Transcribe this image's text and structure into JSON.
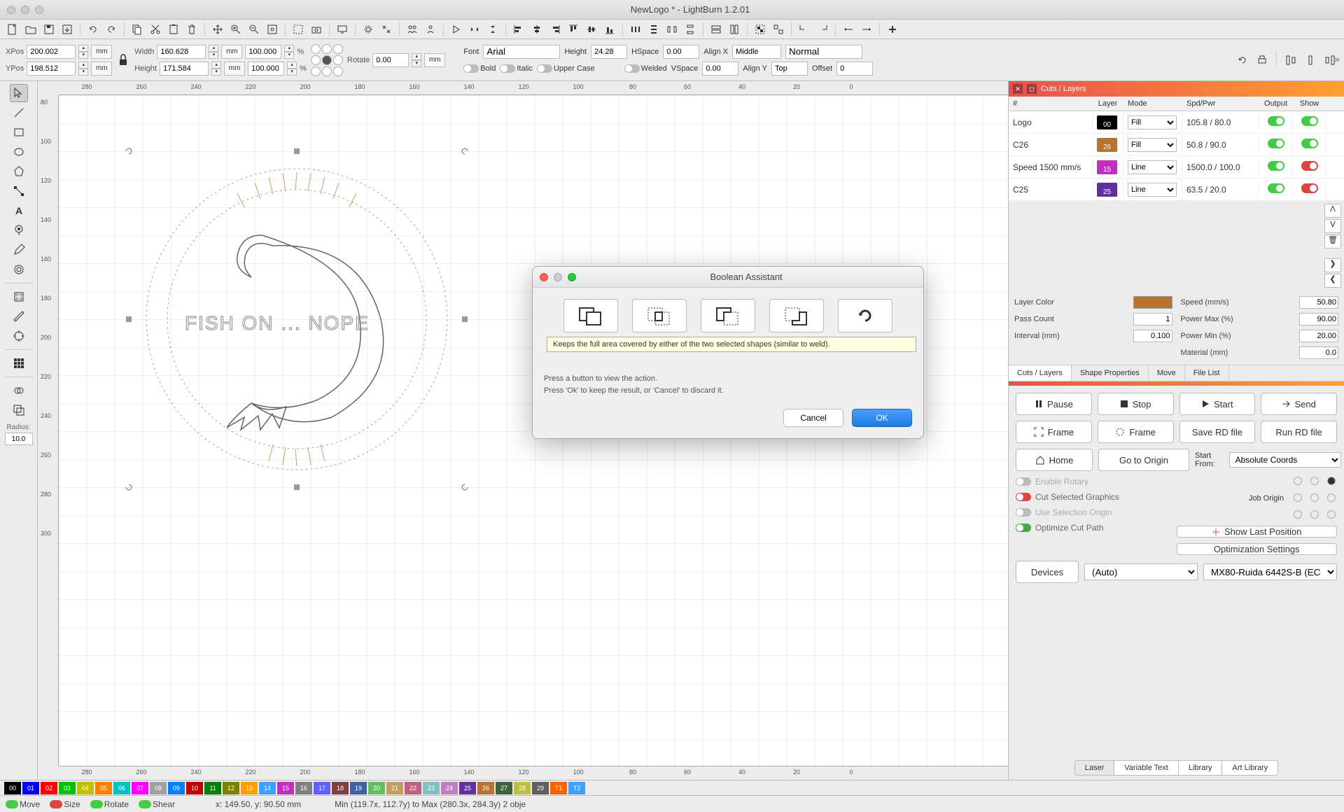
{
  "app": {
    "title": "NewLogo * - LightBurn 1.2.01"
  },
  "props": {
    "xpos_label": "XPos",
    "xpos": "200.002",
    "ypos_label": "YPos",
    "ypos": "198.512",
    "mm": "mm",
    "width_label": "Width",
    "width": "160.628",
    "height_label": "Height",
    "height": "171.584",
    "width_pct": "100.000",
    "height_pct": "100.000",
    "pct": "%",
    "rotate_label": "Rotate",
    "rotate": "0.00"
  },
  "font": {
    "label": "Font",
    "value": "Arial",
    "height_label": "Height",
    "height": "24.28",
    "hspace_label": "HSpace",
    "hspace": "0.00",
    "alignx_label": "Align X",
    "alignx": "Middle",
    "normal": "Normal",
    "bold": "Bold",
    "italic": "Italic",
    "upper": "Upper Case",
    "welded": "Welded",
    "vspace_label": "VSpace",
    "vspace": "0.00",
    "aligny_label": "Align Y",
    "aligny": "Top",
    "offset_label": "Offset",
    "offset": "0"
  },
  "canvas": {
    "ruler_values": [
      "280",
      "260",
      "240",
      "220",
      "200",
      "180",
      "160",
      "140",
      "120",
      "100",
      "80",
      "60",
      "40",
      "20",
      "0"
    ],
    "ruler_v": [
      "80",
      "100",
      "120",
      "140",
      "160",
      "180",
      "200",
      "220",
      "240",
      "260",
      "280",
      "300"
    ],
    "artwork_text": "FISH ON ... NOPE",
    "radius_label": "Radius:",
    "radius": "10.0"
  },
  "cuts": {
    "panel_title": "Cuts / Layers",
    "head_num": "#",
    "head_layer": "Layer",
    "head_mode": "Mode",
    "head_spd": "Spd/Pwr",
    "head_out": "Output",
    "head_show": "Show",
    "rows": [
      {
        "name": "Logo",
        "layer": "00",
        "layercolor": "#000000",
        "mode": "Fill",
        "spd": "105.8 / 80.0",
        "out": true,
        "show": true,
        "showcolor": "green"
      },
      {
        "name": "C26",
        "layer": "26",
        "layercolor": "#b87333",
        "mode": "Fill",
        "spd": "50.8 / 90.0",
        "out": true,
        "show": true,
        "showcolor": "green"
      },
      {
        "name": "Speed 1500 mm/s",
        "layer": "15",
        "layercolor": "#c030c0",
        "mode": "Line",
        "spd": "1500.0 / 100.0",
        "out": true,
        "show": false,
        "showcolor": "red"
      },
      {
        "name": "C25",
        "layer": "25",
        "layercolor": "#6030a0",
        "mode": "Line",
        "spd": "63.5 / 20.0",
        "out": true,
        "show": false,
        "showcolor": "red"
      }
    ],
    "trash": "🗑"
  },
  "layerprops": {
    "layercolor_label": "Layer Color",
    "passcount_label": "Pass Count",
    "passcount": "1",
    "interval_label": "Interval (mm)",
    "interval": "0.100",
    "speed_label": "Speed (mm/s)",
    "speed": "50.80",
    "powermax_label": "Power Max (%)",
    "powermax": "90.00",
    "powermin_label": "Power Min (%)",
    "powermin": "20.00",
    "material_label": "Material (mm)",
    "material": "0.0"
  },
  "tabs": {
    "cuts": "Cuts / Layers",
    "shape": "Shape Properties",
    "move": "Move",
    "filelist": "File List"
  },
  "laser": {
    "pause": "Pause",
    "stop": "Stop",
    "start": "Start",
    "send": "Send",
    "frame": "Frame",
    "frame2": "Frame",
    "saverd": "Save RD file",
    "runrd": "Run RD file",
    "home": "Home",
    "gotoorigin": "Go to Origin",
    "startfrom_label": "Start From:",
    "startfrom": "Absolute Coords",
    "joborigin_label": "Job Origin",
    "enable_rotary": "Enable Rotary",
    "cut_selected": "Cut Selected Graphics",
    "use_selection": "Use Selection Origin",
    "optimize": "Optimize Cut Path",
    "showlast": "Show Last Position",
    "optsettings": "Optimization Settings",
    "devices": "Devices",
    "auto": "(Auto)",
    "device": "MX80-Ruida 6442S-B (EC"
  },
  "bottomtabs": {
    "laser": "Laser",
    "vartext": "Variable Text",
    "library": "Library",
    "artlib": "Art Library"
  },
  "palette": [
    {
      "n": "00",
      "c": "#000000"
    },
    {
      "n": "01",
      "c": "#0000ff"
    },
    {
      "n": "02",
      "c": "#ff0000"
    },
    {
      "n": "03",
      "c": "#00c000"
    },
    {
      "n": "04",
      "c": "#c0c000"
    },
    {
      "n": "05",
      "c": "#ff8000"
    },
    {
      "n": "06",
      "c": "#00c0c0"
    },
    {
      "n": "07",
      "c": "#ff00ff"
    },
    {
      "n": "08",
      "c": "#a0a0a0"
    },
    {
      "n": "09",
      "c": "#0080ff"
    },
    {
      "n": "10",
      "c": "#c00000"
    },
    {
      "n": "11",
      "c": "#008000"
    },
    {
      "n": "12",
      "c": "#808000"
    },
    {
      "n": "13",
      "c": "#ffa000"
    },
    {
      "n": "14",
      "c": "#40a0ff"
    },
    {
      "n": "15",
      "c": "#c030c0"
    },
    {
      "n": "16",
      "c": "#808080"
    },
    {
      "n": "17",
      "c": "#6060ff"
    },
    {
      "n": "18",
      "c": "#804040"
    },
    {
      "n": "19",
      "c": "#4060a0"
    },
    {
      "n": "20",
      "c": "#60c060"
    },
    {
      "n": "21",
      "c": "#c0a060"
    },
    {
      "n": "22",
      "c": "#c06080"
    },
    {
      "n": "23",
      "c": "#80c0c0"
    },
    {
      "n": "24",
      "c": "#c080c0"
    },
    {
      "n": "25",
      "c": "#6030a0"
    },
    {
      "n": "26",
      "c": "#b87333"
    },
    {
      "n": "27",
      "c": "#406040"
    },
    {
      "n": "28",
      "c": "#c0c040"
    },
    {
      "n": "29",
      "c": "#606060"
    },
    {
      "n": "T1",
      "c": "#ff6000"
    },
    {
      "n": "T2",
      "c": "#40a0ff"
    }
  ],
  "status": {
    "move": "Move",
    "size": "Size",
    "rotate": "Rotate",
    "shear": "Shear",
    "coords": "x: 149.50, y: 90.50 mm",
    "bounds": "Min (119.7x, 112.7y) to Max (280.3x, 284.3y)  2 obje"
  },
  "dialog": {
    "title": "Boolean Assistant",
    "labels": [
      "A or B",
      "A and B",
      "A - B",
      "B - A"
    ],
    "tooltip": "Keeps the full area covered by either of the two selected shapes (similar to weld).",
    "instr1": "Press a button to view the action.",
    "instr2": "Press 'Ok' to keep the result, or 'Cancel' to discard it.",
    "cancel": "Cancel",
    "ok": "OK"
  }
}
